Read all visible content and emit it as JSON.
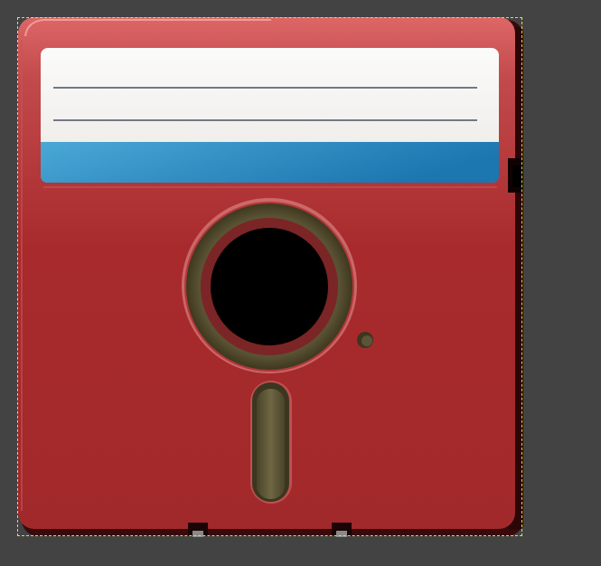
{
  "canvas": {
    "background": "#434343"
  },
  "selection": {
    "style": "dashed",
    "color": "#e8e03a"
  },
  "floppy_disk_icon": {
    "colors": {
      "body": "#a8282a",
      "body_top": "#d86464",
      "body_shadow": "#3b0a0a",
      "label_paper": "#f2f1ee",
      "label_line": "#6e7280",
      "label_stripe_left": "#4aa8d6",
      "label_stripe_right": "#1e78b2",
      "hub_ring": "#5a5234",
      "hub_inner_ring": "#7a2526",
      "spindle_hole": "#000000",
      "read_slot": "#5d5638"
    },
    "label_lines": 2,
    "notches": 2
  }
}
